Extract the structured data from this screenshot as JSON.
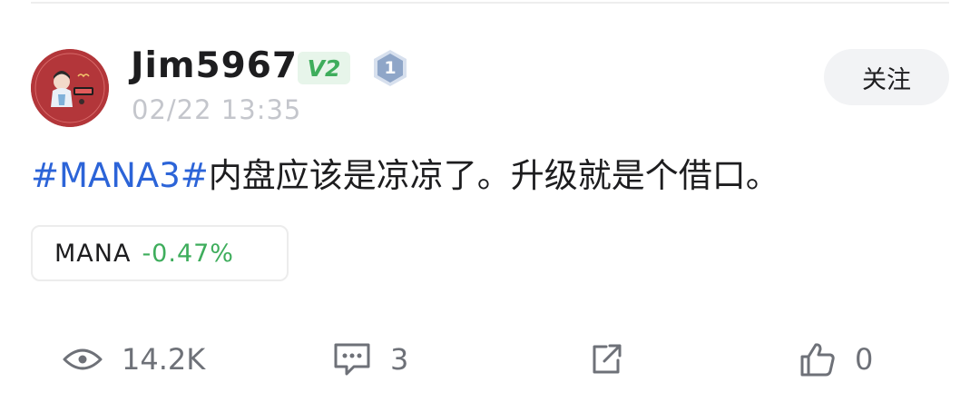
{
  "author": {
    "username": "Jim5967",
    "vip_badge": "V2",
    "level_badge": "1",
    "timestamp": "02/22 13:35"
  },
  "follow_button_label": "关注",
  "post": {
    "hashtag": "#MANA3#",
    "body": "内盘应该是凉凉了。升级就是个借口。"
  },
  "ticker": {
    "symbol": "MANA",
    "change": "-0.47%"
  },
  "stats": {
    "views": "14.2K",
    "comments": "3",
    "likes": "0"
  },
  "colors": {
    "hashtag": "#2c64d8",
    "price_change": "#3ead5c",
    "vip_badge_bg": "#e7f5ea",
    "level_badge": "#8fa6c8",
    "muted_text": "#c4c6cc"
  },
  "icons": [
    "eye-icon",
    "comment-icon",
    "share-icon",
    "thumbs-up-icon"
  ]
}
